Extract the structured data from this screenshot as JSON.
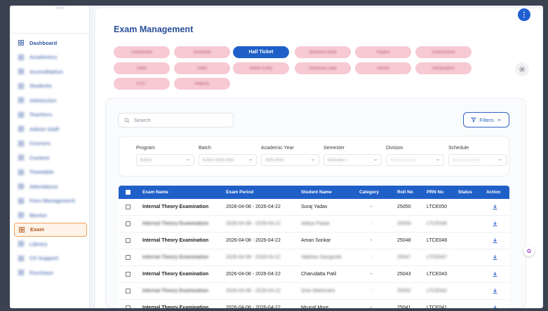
{
  "sidebar": {
    "items": [
      {
        "label": "Dashboard",
        "icon": "grid-icon",
        "blurred": false,
        "active": false
      },
      {
        "label": "Academics",
        "icon": "academics-icon",
        "blurred": true,
        "active": false
      },
      {
        "label": "Accreditation",
        "icon": "accreditation-icon",
        "blurred": true,
        "active": false
      },
      {
        "label": "Students",
        "icon": "students-icon",
        "blurred": true,
        "active": false
      },
      {
        "label": "Admission",
        "icon": "admission-icon",
        "blurred": true,
        "active": false
      },
      {
        "label": "Teachers",
        "icon": "teachers-icon",
        "blurred": true,
        "active": false
      },
      {
        "label": "Admin Staff",
        "icon": "staff-icon",
        "blurred": true,
        "active": false
      },
      {
        "label": "Courses",
        "icon": "courses-icon",
        "blurred": true,
        "active": false
      },
      {
        "label": "Content",
        "icon": "content-icon",
        "blurred": true,
        "active": false
      },
      {
        "label": "Timetable",
        "icon": "timetable-icon",
        "blurred": true,
        "active": false
      },
      {
        "label": "Attendance",
        "icon": "attendance-icon",
        "blurred": true,
        "active": false
      },
      {
        "label": "Fees Management",
        "icon": "fees-icon",
        "blurred": true,
        "active": false
      },
      {
        "label": "Mentor",
        "icon": "mentor-icon",
        "blurred": true,
        "active": false
      },
      {
        "label": "Exam",
        "icon": "exam-icon",
        "blurred": false,
        "active": true
      },
      {
        "label": "Library",
        "icon": "library-icon",
        "blurred": true,
        "active": false
      },
      {
        "label": "CS Support",
        "icon": "support-icon",
        "blurred": true,
        "active": false
      },
      {
        "label": "Purchase",
        "icon": "purchase-icon",
        "blurred": true,
        "active": false
      }
    ]
  },
  "header": {
    "title": "Exam Management",
    "menu_icon": "more-vertical-icon"
  },
  "tabs": [
    {
      "label": "Dashboard",
      "active": false
    },
    {
      "label": "Schedule",
      "active": false
    },
    {
      "label": "Hall Ticket",
      "active": true
    },
    {
      "label": "Question Bank",
      "active": false
    },
    {
      "label": "Papers",
      "active": false
    },
    {
      "label": "Assessment",
      "active": false
    },
    {
      "label": "OMR",
      "active": false
    },
    {
      "label": "OMR",
      "active": false
    },
    {
      "label": "Marks Entry",
      "active": false
    },
    {
      "label": "Historical Data",
      "active": false
    },
    {
      "label": "Result",
      "active": false
    },
    {
      "label": "Revaluation",
      "active": false
    },
    {
      "label": "ATKT",
      "active": false
    },
    {
      "label": "Reports",
      "active": false
    }
  ],
  "search": {
    "placeholder": "Search"
  },
  "filters_button": {
    "label": "Filters"
  },
  "filter_fields": [
    {
      "label": "Program",
      "value": "B.Arch"
    },
    {
      "label": "Batch",
      "value": "B.Arch 2025-2030"
    },
    {
      "label": "Academic Year",
      "value": "2025-2026"
    },
    {
      "label": "Semester",
      "value": "Semester 1"
    },
    {
      "label": "Division",
      "value": "Select Division"
    },
    {
      "label": "Schedule",
      "value": "Select Schedule"
    }
  ],
  "table": {
    "headers": [
      "Exam Name",
      "Exam Period",
      "Student Name",
      "Category",
      "Roll No",
      "PRN No",
      "Status",
      "Action"
    ],
    "rows": [
      {
        "exam": "Internal Theory Examination",
        "period": "2026-04-08 - 2026-04-22",
        "student": "Suraj Yadav",
        "category": "-",
        "roll": "25050",
        "prn": "LTCE050",
        "blurred": false
      },
      {
        "exam": "Internal Theory Examination",
        "period": "2026-04-08 - 2026-04-22",
        "student": "Aditya Pawar",
        "category": "-",
        "roll": "25049",
        "prn": "LTCE049",
        "blurred": true
      },
      {
        "exam": "Internal Theory Examination",
        "period": "2026-04-08 - 2026-04-22",
        "student": "Aman Sonkar",
        "category": "-",
        "roll": "25048",
        "prn": "LTCE048",
        "blurred": false
      },
      {
        "exam": "Internal Theory Examination",
        "period": "2026-04-08 - 2026-04-22",
        "student": "Vaibhav Gangurde",
        "category": "-",
        "roll": "25047",
        "prn": "LTCE047",
        "blurred": true
      },
      {
        "exam": "Internal Theory Examination",
        "period": "2026-04-08 - 2026-04-22",
        "student": "Charudatta Patil",
        "category": "-",
        "roll": "25043",
        "prn": "LTCE043",
        "blurred": false
      },
      {
        "exam": "Internal Theory Examination",
        "period": "2026-04-08 - 2026-04-22",
        "student": "Sree Mahendra",
        "category": "-",
        "roll": "25042",
        "prn": "LTCE042",
        "blurred": true
      },
      {
        "exam": "Internal Theory Examination",
        "period": "2026-04-08 - 2026-04-22",
        "student": "Mrunal More",
        "category": "-",
        "roll": "25041",
        "prn": "LTCE041",
        "blurred": false
      }
    ]
  },
  "colors": {
    "primary": "#1f5fc8",
    "title": "#2a4f9a",
    "pill": "#f7c9d3",
    "active_nav": "#fff3e8"
  }
}
